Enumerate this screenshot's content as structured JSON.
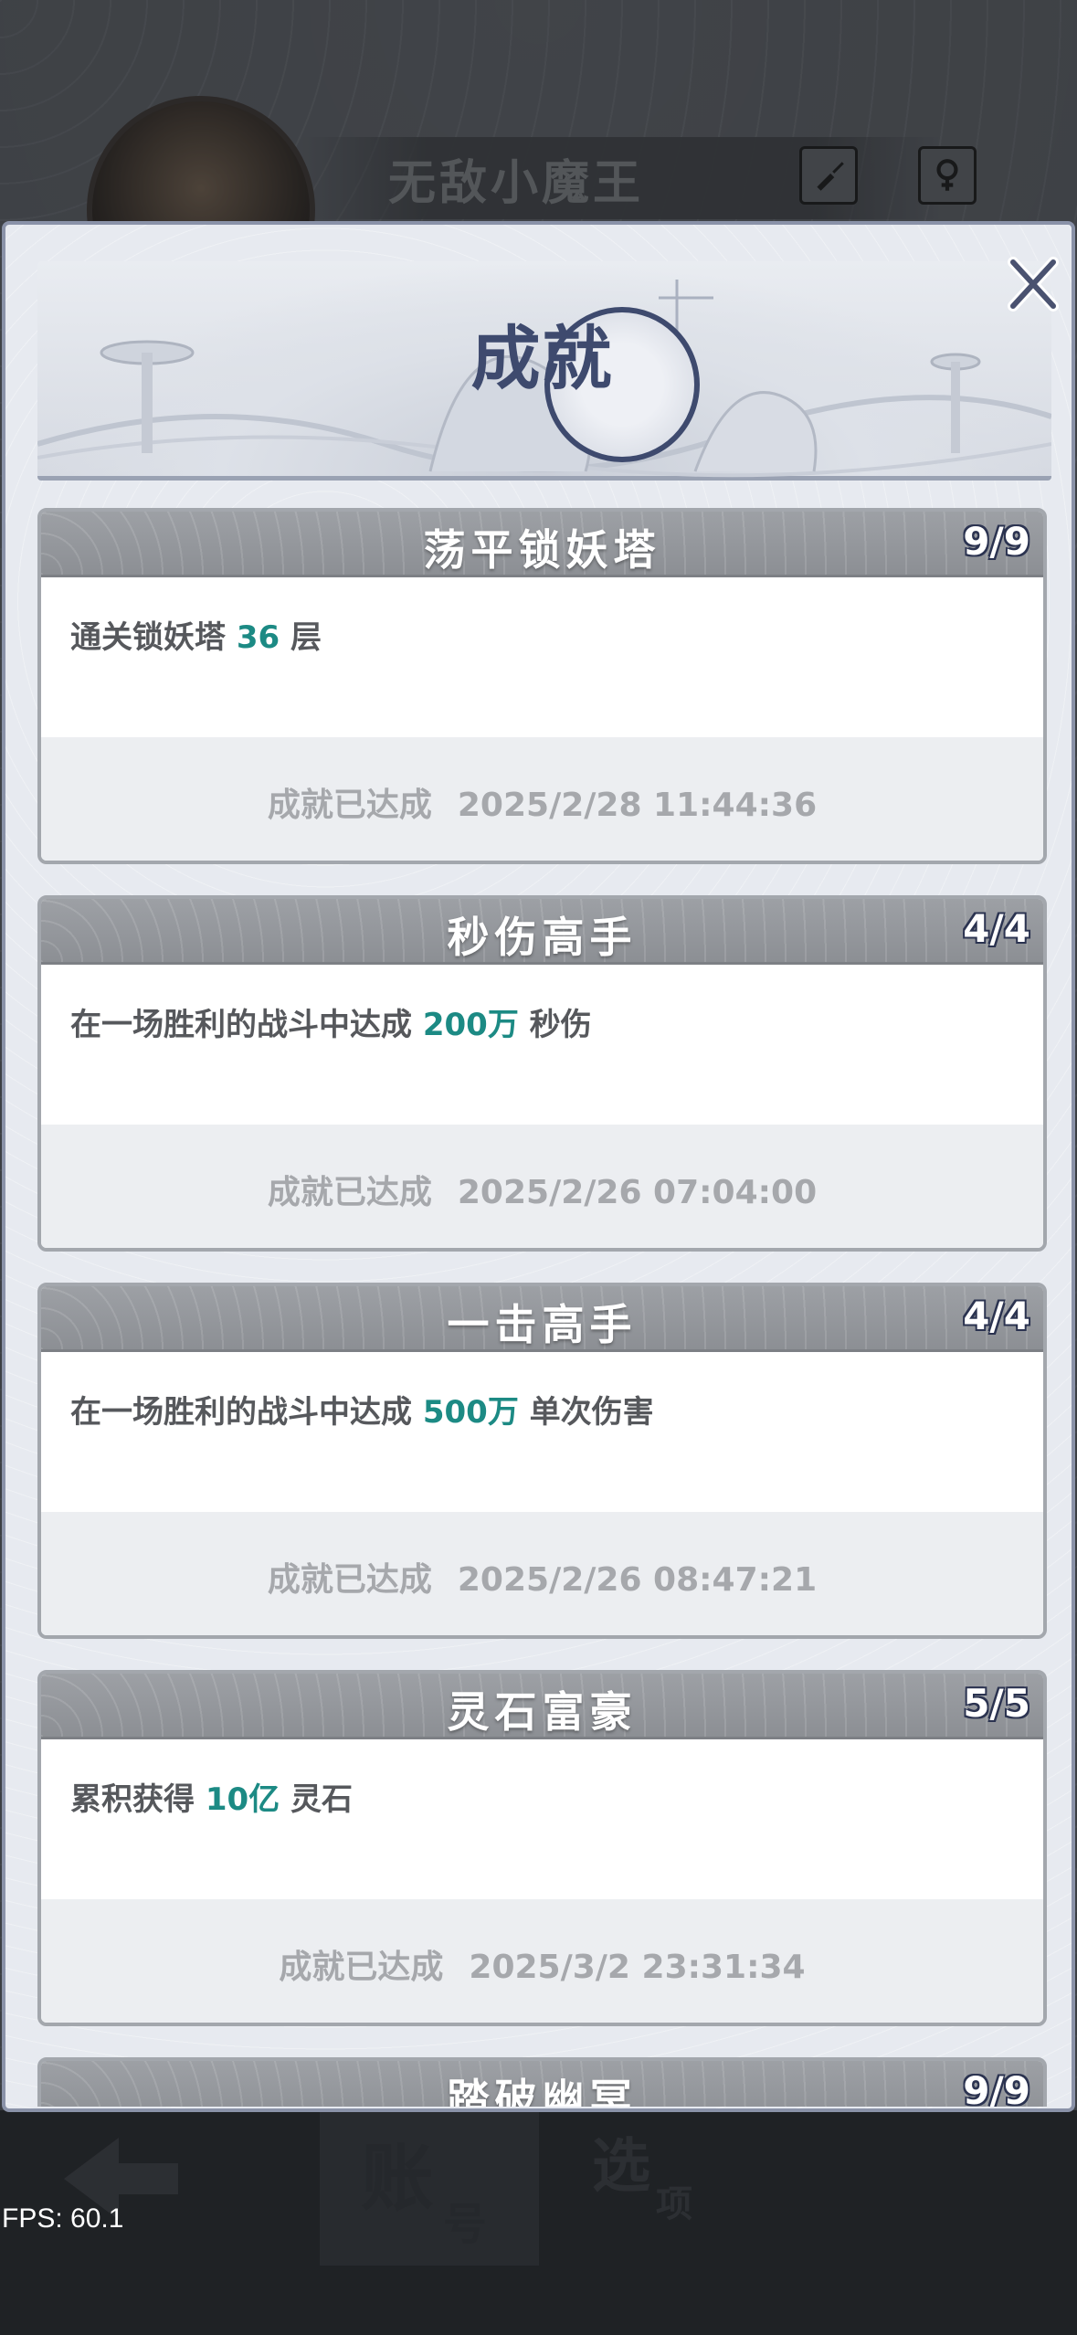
{
  "background": {
    "player_name": "无敌小魔王",
    "tabs": [
      {
        "main": "账",
        "sub": "号"
      },
      {
        "main": "选",
        "sub": "项"
      }
    ],
    "fps": "FPS: 60.1"
  },
  "modal": {
    "title": "成就",
    "close_label": "X"
  },
  "achievements": [
    {
      "title": "荡平锁妖塔",
      "progress": "9/9",
      "desc_prefix": "通关锁妖塔 ",
      "desc_value": "36",
      "desc_suffix": " 层",
      "status": "成就已达成",
      "time": "2025/2/28 11:44:36"
    },
    {
      "title": "秒伤高手",
      "progress": "4/4",
      "desc_prefix": "在一场胜利的战斗中达成 ",
      "desc_value": "200万",
      "desc_suffix": " 秒伤",
      "status": "成就已达成",
      "time": "2025/2/26 07:04:00"
    },
    {
      "title": "一击高手",
      "progress": "4/4",
      "desc_prefix": "在一场胜利的战斗中达成 ",
      "desc_value": "500万",
      "desc_suffix": " 单次伤害",
      "status": "成就已达成",
      "time": "2025/2/26 08:47:21"
    },
    {
      "title": "灵石富豪",
      "progress": "5/5",
      "desc_prefix": "累积获得 ",
      "desc_value": "10亿",
      "desc_suffix": " 灵石",
      "status": "成就已达成",
      "time": "2025/3/2 23:31:34"
    },
    {
      "title": "踏破幽冥",
      "progress": "9/9"
    }
  ],
  "colors": {
    "highlight": "#1c8a84",
    "header_bg": "#8c8f94",
    "title_ink": "#3e4a6e"
  }
}
